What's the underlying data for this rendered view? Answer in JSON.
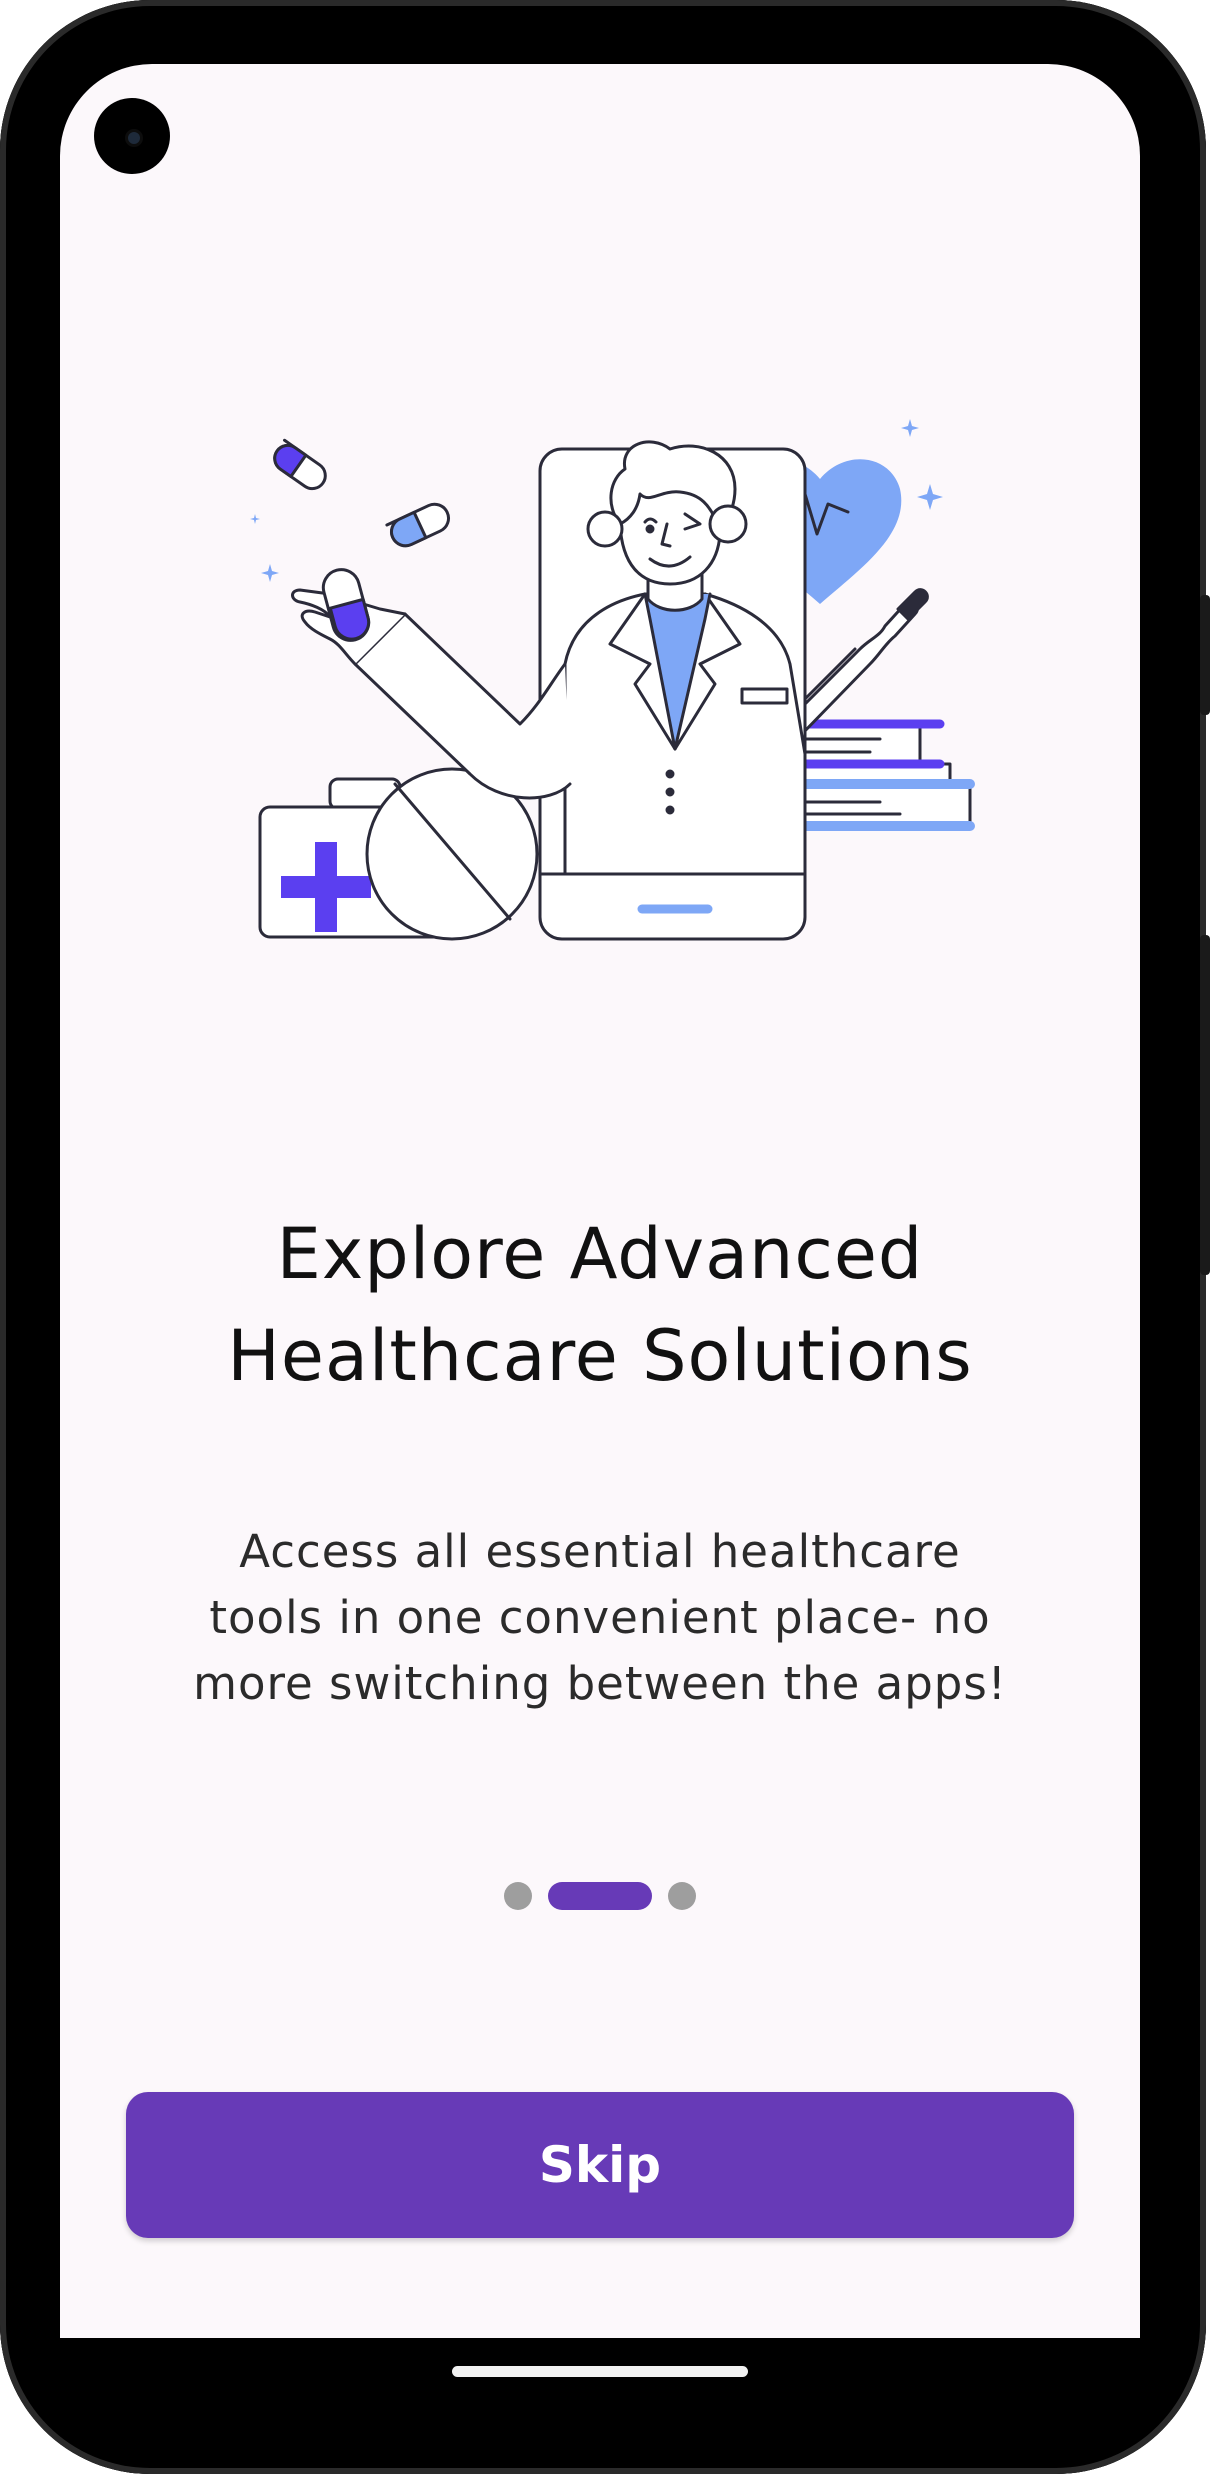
{
  "onboarding": {
    "title_lines": [
      "Explore Advanced",
      "Healthcare Solutions"
    ],
    "subtitle_lines": [
      "Access all essential healthcare",
      "tools in one convenient place- no",
      "more switching between the apps!"
    ],
    "page_indicator": {
      "total": 3,
      "active_index": 1
    },
    "skip_label": "Skip"
  },
  "illustration": {
    "icons": [
      "doctor-icon",
      "smartphone-icon",
      "heart-pulse-icon",
      "thermometer-icon",
      "first-aid-kit-icon",
      "pill-icon",
      "books-icon",
      "sparkle-icon"
    ]
  },
  "colors": {
    "primary": "#673ab7",
    "background": "#fcf8fb",
    "dot_inactive": "#9e9e9e",
    "illustration_blue": "#7ea7f6",
    "illustration_purple": "#5b3ff0"
  }
}
